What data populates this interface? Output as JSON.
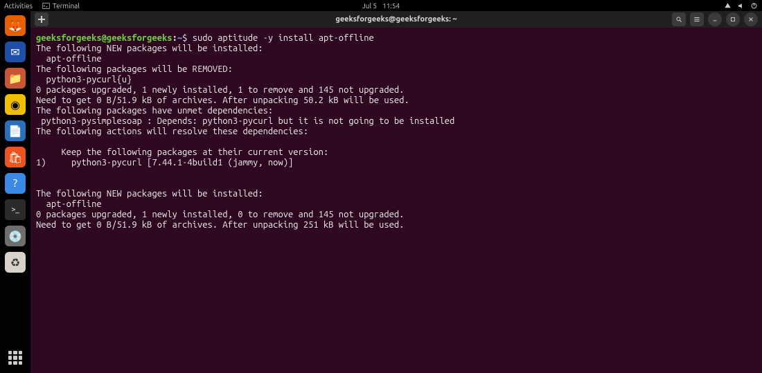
{
  "top": {
    "activities": "Activities",
    "appmenu": "Terminal",
    "date": "Jul 5",
    "time": "11:54"
  },
  "dock": {
    "items": [
      {
        "name": "firefox",
        "bg": "#e66000",
        "glyph": "🦊"
      },
      {
        "name": "thunderbird",
        "bg": "#1f4fa8",
        "glyph": "✉"
      },
      {
        "name": "files",
        "bg": "#ca5536",
        "glyph": "📁"
      },
      {
        "name": "rhythmbox",
        "bg": "#111",
        "glyph": "🔊"
      },
      {
        "name": "libreoffice",
        "bg": "#2c6fbb",
        "glyph": "📄"
      },
      {
        "name": "software",
        "bg": "#e95420",
        "glyph": "🛍"
      },
      {
        "name": "help",
        "bg": "#3c8ae6",
        "glyph": "?"
      },
      {
        "name": "terminal",
        "bg": "#2b2b2b",
        "glyph": ">_"
      },
      {
        "name": "disks",
        "bg": "#6e6e6e",
        "glyph": "💿"
      },
      {
        "name": "trash",
        "bg": "#d7d3cb",
        "glyph": "🗑"
      }
    ]
  },
  "window": {
    "title": "geeksforgeeks@geeksforgeeks: ~"
  },
  "prompt": {
    "user": "geeksforgeeks@geeksforgeeks",
    "sep": ":",
    "path": "~",
    "sigil": "$",
    "command": "sudo aptitude -y install apt-offline"
  },
  "lines": {
    "l1": "The following NEW packages will be installed:",
    "l2": "  apt-offline",
    "l3": "The following packages will be REMOVED:",
    "l4": "  python3-pycurl{u}",
    "l5": "0 packages upgraded, 1 newly installed, 1 to remove and 145 not upgraded.",
    "l6": "Need to get 0 B/51.9 kB of archives. After unpacking 50.2 kB will be used.",
    "l7": "The following packages have unmet dependencies:",
    "l8": " python3-pysimplesoap : Depends: python3-pycurl but it is not going to be installed",
    "l9": "The following actions will resolve these dependencies:",
    "l10": "",
    "l11": "     Keep the following packages at their current version:",
    "l12": "1)     python3-pycurl [7.44.1-4build1 (jammy, now)]",
    "l13": "",
    "l14": "",
    "l15": "The following NEW packages will be installed:",
    "l16": "  apt-offline",
    "l17": "0 packages upgraded, 1 newly installed, 0 to remove and 145 not upgraded.",
    "l18": "Need to get 0 B/51.9 kB of archives. After unpacking 251 kB will be used."
  }
}
